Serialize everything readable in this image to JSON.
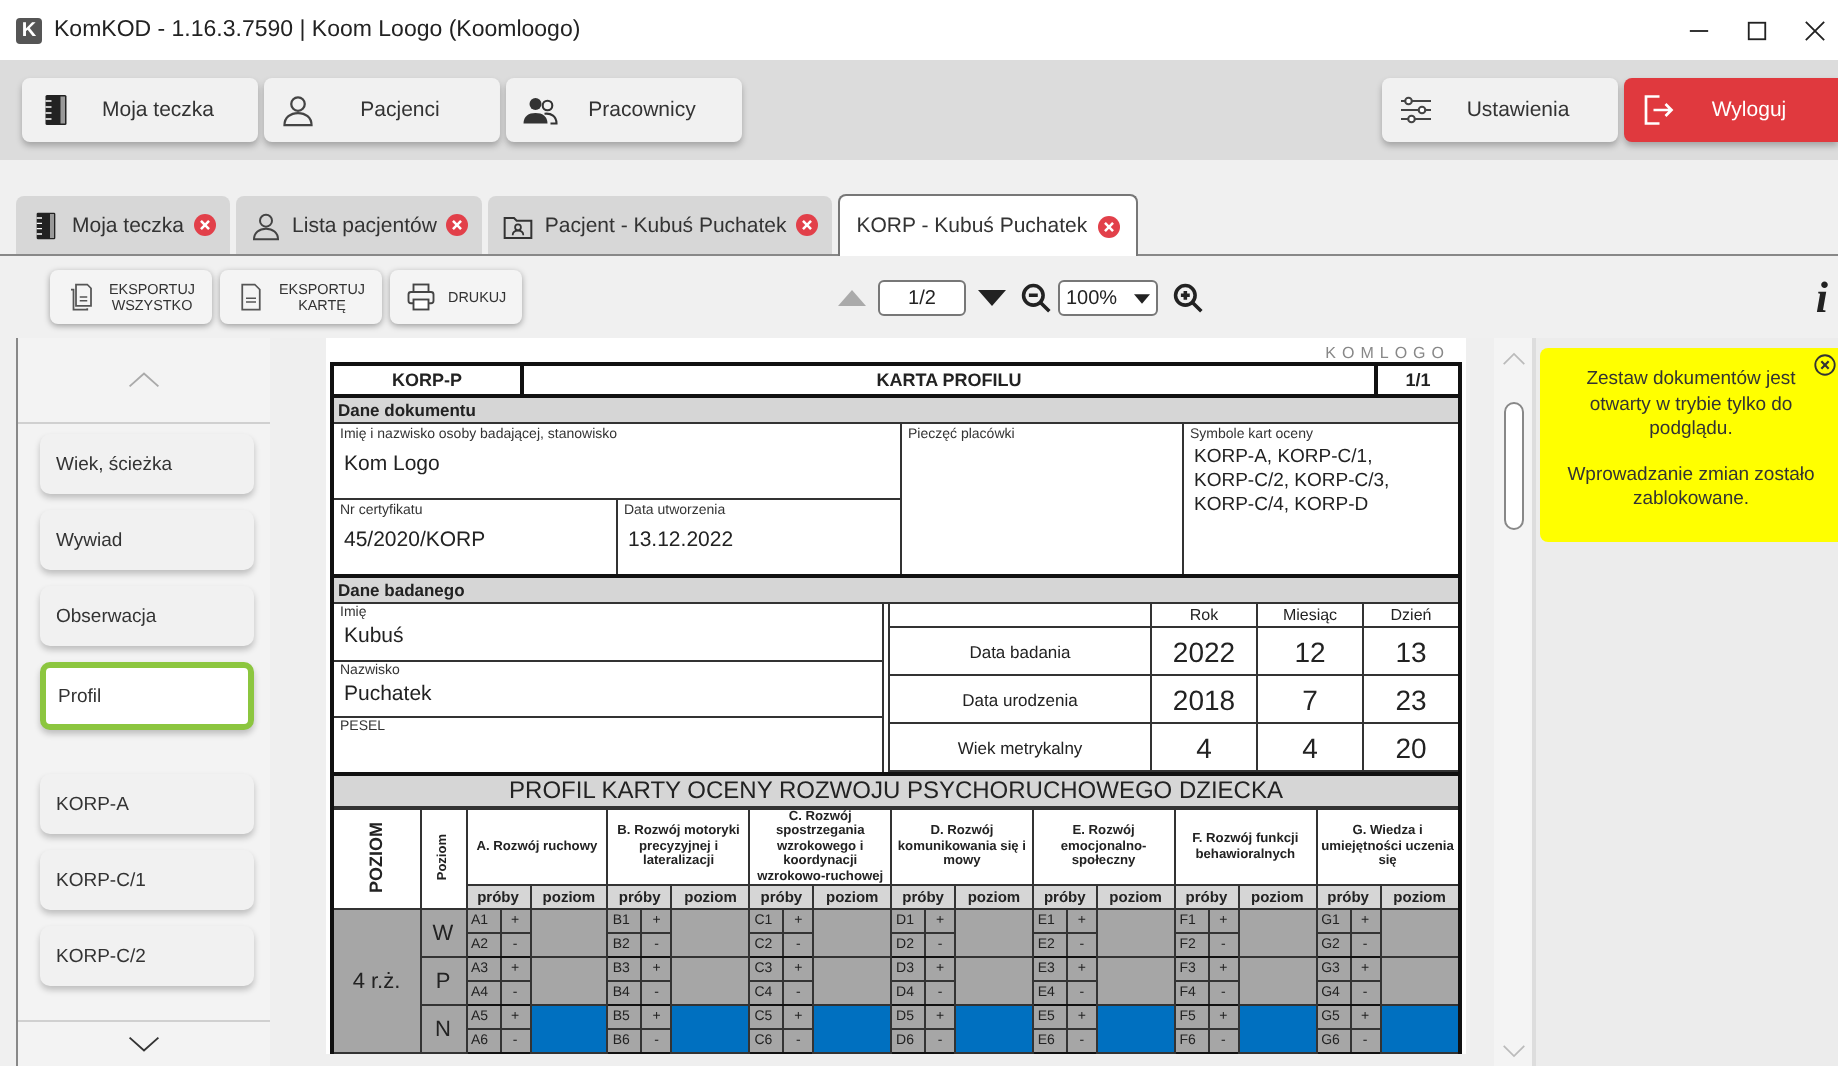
{
  "window": {
    "app_icon": "K",
    "title": "KomKOD - 1.16.3.7590 | Koom Loogo (Koomloogo)"
  },
  "nav": {
    "left": [
      {
        "label": "Moja teczka",
        "kind": "binder"
      },
      {
        "label": "Pacjenci",
        "kind": "person"
      },
      {
        "label": "Pracownicy",
        "kind": "people"
      }
    ],
    "right": [
      {
        "label": "Ustawienia",
        "kind": "sliders"
      },
      {
        "label": "Wyloguj",
        "kind": "logout"
      }
    ]
  },
  "tabs": [
    {
      "label": "Moja teczka",
      "kind": "binder",
      "selected": false
    },
    {
      "label": "Lista pacjentów",
      "kind": "person",
      "selected": false
    },
    {
      "label": "Pacjent - Kubuś Puchatek",
      "kind": "folder",
      "selected": false
    },
    {
      "label": "KORP - Kubuś Puchatek",
      "kind": "plain",
      "selected": true
    }
  ],
  "toolbar": {
    "buttons": [
      {
        "label": "EKSPORTUJ WSZYSTKO",
        "kind": "documents"
      },
      {
        "label": "EKSPORTUJ KARTĘ",
        "kind": "document"
      },
      {
        "label": "DRUKUJ",
        "kind": "printer"
      }
    ],
    "page": "1/2",
    "zoom": "100%",
    "info": "i"
  },
  "sidebar": {
    "groups": [
      {
        "items": [
          {
            "label": "Wiek, ścieżka",
            "selected": false
          },
          {
            "label": "Wywiad",
            "selected": false
          },
          {
            "label": "Obserwacja",
            "selected": false
          },
          {
            "label": "Profil",
            "selected": true
          }
        ]
      },
      {
        "items": [
          {
            "label": "KORP-A",
            "selected": false
          },
          {
            "label": "KORP-C/1",
            "selected": false
          },
          {
            "label": "KORP-C/2",
            "selected": false
          }
        ]
      }
    ]
  },
  "document": {
    "logo": "KOMLOGO",
    "code": "KORP-P",
    "title": "KARTA PROFILU",
    "page": "1/1",
    "doc_section": "Dane dokumentu",
    "examiner": {
      "label": "Imię i nazwisko osoby badającej, stanowisko",
      "value": "Kom Logo"
    },
    "certificate": {
      "label": "Nr certyfikatu",
      "value": "45/2020/KORP"
    },
    "created": {
      "label": "Data utworzenia",
      "value": "13.12.2022"
    },
    "stamp": {
      "label": "Pieczęć placówki"
    },
    "symbols": {
      "label": "Symbole kart oceny",
      "value": "KORP-A, KORP-C/1, KORP-C/2, KORP-C/3, KORP-C/4, KORP-D"
    },
    "subject_section": "Dane badanego",
    "subject_fields": [
      {
        "label": "Imię",
        "value": "Kubuś"
      },
      {
        "label": "Nazwisko",
        "value": "Puchatek"
      },
      {
        "label": "PESEL"
      }
    ],
    "dates": {
      "columns": [
        "Rok",
        "Miesiąc",
        "Dzień"
      ],
      "rows": [
        {
          "label": "Data badania",
          "values": [
            "2022",
            "12",
            "13"
          ]
        },
        {
          "label": "Data urodzenia",
          "values": [
            "2018",
            "7",
            "23"
          ]
        },
        {
          "label": "Wiek metrykalny",
          "values": [
            "4",
            "4",
            "20"
          ]
        }
      ]
    },
    "profile": {
      "title": "PROFIL KARTY OCENY ROZWOJU PSYCHORUCHOWEGO DZIECKA",
      "level_header": "POZIOM",
      "sublevel_header": "Poziom",
      "domains": [
        {
          "title": "A. Rozwój ruchowy",
          "subheads": [
            "próby",
            "poziom"
          ]
        },
        {
          "title": "B. Rozwój motoryki precyzyjnej i lateralizacji",
          "subheads": [
            "próby",
            "poziom"
          ]
        },
        {
          "title": "C. Rozwój spostrzegania wzrokowego i koordynacji wzrokowo-ruchowej",
          "subheads": [
            "próby",
            "poziom"
          ]
        },
        {
          "title": "D. Rozwój komunikowania się i mowy",
          "subheads": [
            "próby",
            "poziom"
          ]
        },
        {
          "title": "E. Rozwój emocjonalno-społeczny",
          "subheads": [
            "próby",
            "poziom"
          ]
        },
        {
          "title": "F. Rozwój funkcji behawioralnych",
          "subheads": [
            "próby",
            "poziom"
          ]
        },
        {
          "title": "G. Wiedza i umiejętności uczenia się",
          "subheads": [
            "próby",
            "poziom"
          ]
        }
      ],
      "age_groups": [
        {
          "label": "4 r.ż.",
          "levels": [
            {
              "label": "W",
              "highlighted": false,
              "trials": [
                [
                  {
                    "code": "A1",
                    "mark": "+"
                  },
                  {
                    "code": "A2",
                    "mark": "-"
                  }
                ],
                [
                  {
                    "code": "B1",
                    "mark": "+"
                  },
                  {
                    "code": "B2",
                    "mark": "-"
                  }
                ],
                [
                  {
                    "code": "C1",
                    "mark": "+"
                  },
                  {
                    "code": "C2",
                    "mark": "-"
                  }
                ],
                [
                  {
                    "code": "D1",
                    "mark": "+"
                  },
                  {
                    "code": "D2",
                    "mark": "-"
                  }
                ],
                [
                  {
                    "code": "E1",
                    "mark": "+"
                  },
                  {
                    "code": "E2",
                    "mark": "-"
                  }
                ],
                [
                  {
                    "code": "F1",
                    "mark": "+"
                  },
                  {
                    "code": "F2",
                    "mark": "-"
                  }
                ],
                [
                  {
                    "code": "G1",
                    "mark": "+"
                  },
                  {
                    "code": "G2",
                    "mark": "-"
                  }
                ]
              ]
            },
            {
              "label": "P",
              "highlighted": false,
              "trials": [
                [
                  {
                    "code": "A3",
                    "mark": "+"
                  },
                  {
                    "code": "A4",
                    "mark": "-"
                  }
                ],
                [
                  {
                    "code": "B3",
                    "mark": "+"
                  },
                  {
                    "code": "B4",
                    "mark": "-"
                  }
                ],
                [
                  {
                    "code": "C3",
                    "mark": "+"
                  },
                  {
                    "code": "C4",
                    "mark": "-"
                  }
                ],
                [
                  {
                    "code": "D3",
                    "mark": "+"
                  },
                  {
                    "code": "D4",
                    "mark": "-"
                  }
                ],
                [
                  {
                    "code": "E3",
                    "mark": "+"
                  },
                  {
                    "code": "E4",
                    "mark": "-"
                  }
                ],
                [
                  {
                    "code": "F3",
                    "mark": "+"
                  },
                  {
                    "code": "F4",
                    "mark": "-"
                  }
                ],
                [
                  {
                    "code": "G3",
                    "mark": "+"
                  },
                  {
                    "code": "G4",
                    "mark": "-"
                  }
                ]
              ]
            },
            {
              "label": "N",
              "highlighted": true,
              "trials": [
                [
                  {
                    "code": "A5",
                    "mark": "+"
                  },
                  {
                    "code": "A6",
                    "mark": "-"
                  }
                ],
                [
                  {
                    "code": "B5",
                    "mark": "+"
                  },
                  {
                    "code": "B6",
                    "mark": "-"
                  }
                ],
                [
                  {
                    "code": "C5",
                    "mark": "+"
                  },
                  {
                    "code": "C6",
                    "mark": "-"
                  }
                ],
                [
                  {
                    "code": "D5",
                    "mark": "+"
                  },
                  {
                    "code": "D6",
                    "mark": "-"
                  }
                ],
                [
                  {
                    "code": "E5",
                    "mark": "+"
                  },
                  {
                    "code": "E6",
                    "mark": "-"
                  }
                ],
                [
                  {
                    "code": "F5",
                    "mark": "+"
                  },
                  {
                    "code": "F6",
                    "mark": "-"
                  }
                ],
                [
                  {
                    "code": "G5",
                    "mark": "+"
                  },
                  {
                    "code": "G6",
                    "mark": "-"
                  }
                ]
              ]
            }
          ]
        }
      ]
    }
  },
  "notice": {
    "paragraphs": [
      "Zestaw dokumentów jest otwarty w trybie tylko do podglądu.",
      "Wprowadzanie zmian zostało zablokowane."
    ]
  }
}
